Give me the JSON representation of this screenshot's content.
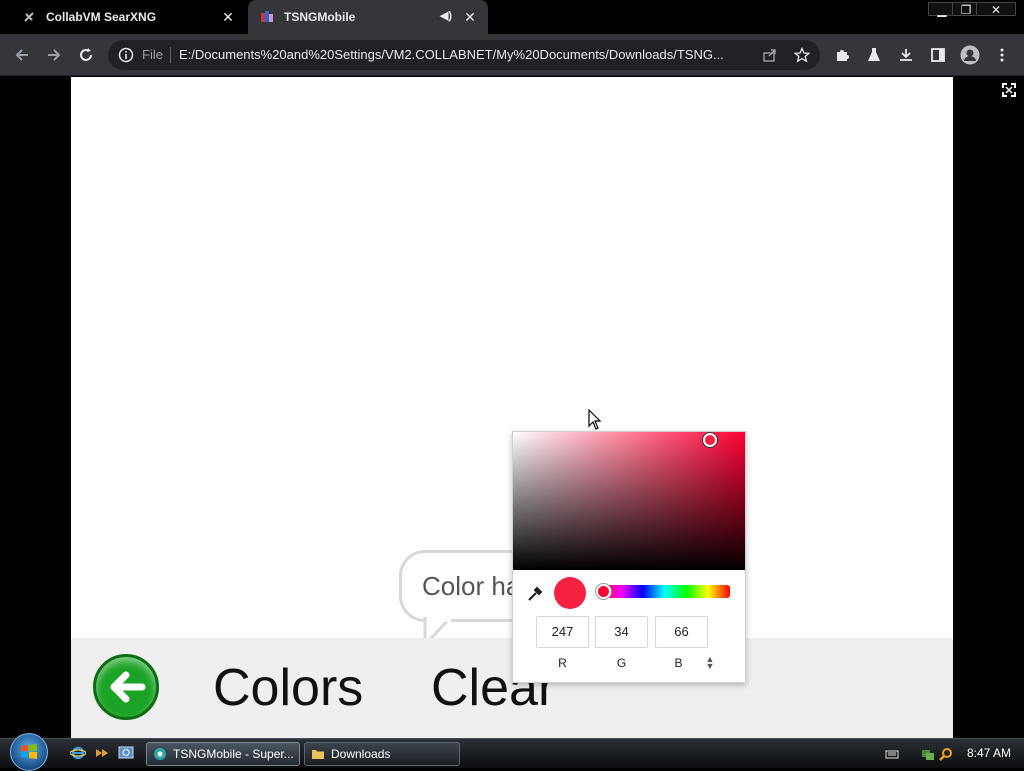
{
  "browser": {
    "tabs": [
      {
        "title": "CollabVM SearXNG",
        "active": false
      },
      {
        "title": "TSNGMobile",
        "active": true,
        "audio": true
      }
    ],
    "omnibox": {
      "scheme_label": "File",
      "url": "E:/Documents%20and%20Settings/VM2.COLLABNET/My%20Documents/Downloads/TSNG..."
    }
  },
  "page": {
    "bubble_text": "Color ha",
    "colors_label": "Colors",
    "clear_label": "Clear",
    "picker": {
      "hue_color": "#ff0033",
      "selected_color": "#f72242",
      "r": "247",
      "g": "34",
      "b": "66",
      "r_label": "R",
      "g_label": "G",
      "b_label": "B"
    }
  },
  "taskbar": {
    "tasks": [
      {
        "label": "TSNGMobile - Super...",
        "active": true
      },
      {
        "label": "Downloads",
        "active": false
      }
    ],
    "clock": "8:47 AM"
  }
}
